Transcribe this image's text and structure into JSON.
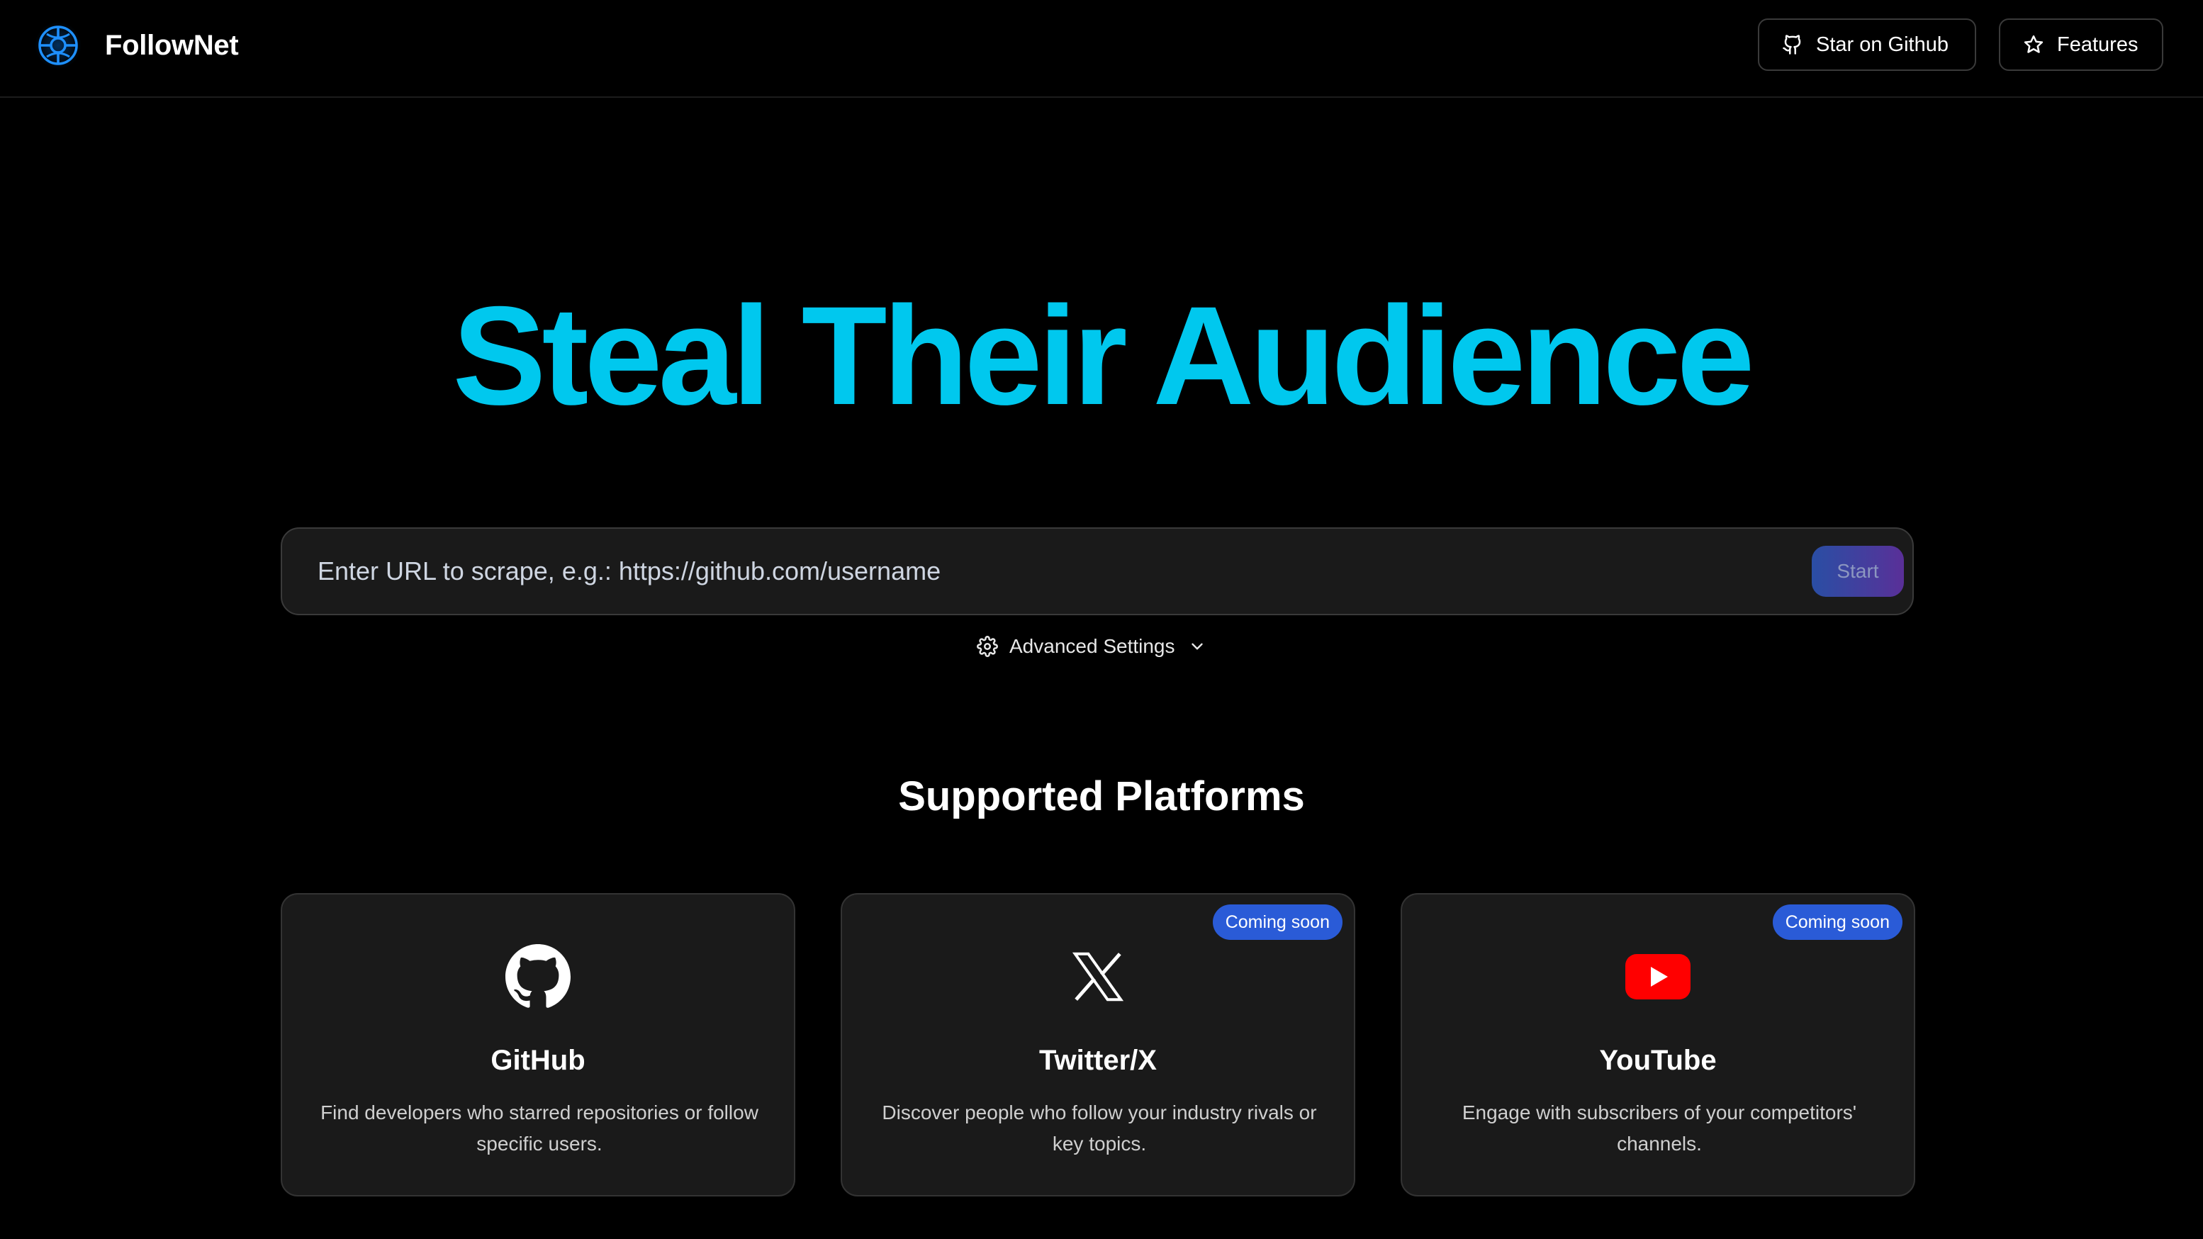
{
  "header": {
    "brand_name": "FollowNet",
    "github_button": "Star on Github",
    "features_button": "Features"
  },
  "hero": {
    "title": "Steal Their Audience"
  },
  "search": {
    "placeholder": "Enter URL to scrape, e.g.: https://github.com/username",
    "start_label": "Start",
    "advanced_label": "Advanced Settings"
  },
  "platforms": {
    "title": "Supported Platforms",
    "items": [
      {
        "name": "GitHub",
        "icon": "github-icon",
        "badge": "",
        "description": "Find developers who starred repositories or follow specific users."
      },
      {
        "name": "Twitter/X",
        "icon": "x-icon",
        "badge": "Coming soon",
        "description": "Discover people who follow your industry rivals or key topics."
      },
      {
        "name": "YouTube",
        "icon": "youtube-icon",
        "badge": "Coming soon",
        "description": "Engage with subscribers of your competitors' channels."
      }
    ]
  },
  "colors": {
    "accent": "#00c8ee",
    "badge": "#2a5bd7",
    "youtube_red": "#ff0000",
    "background": "#000000",
    "card_background": "#1a1a1a"
  }
}
